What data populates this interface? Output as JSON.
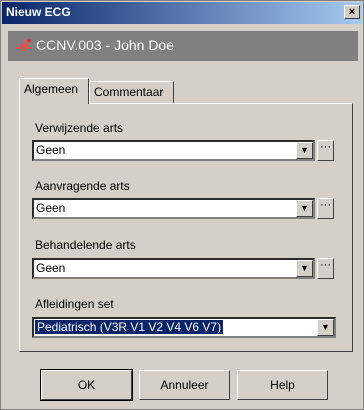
{
  "window": {
    "title": "Nieuw ECG",
    "close_label": "×"
  },
  "header": {
    "icon": "ecg-heart-icon",
    "text": "CCNV.003 - John Doe"
  },
  "tabs": [
    {
      "label": "Algemeen",
      "active": true
    },
    {
      "label": "Commentaar",
      "active": false
    }
  ],
  "fields": {
    "referring": {
      "label": "Verwijzende arts",
      "value": "Geen"
    },
    "requesting": {
      "label": "Aanvragende arts",
      "value": "Geen"
    },
    "treating": {
      "label": "Behandelende arts",
      "value": "Geen"
    },
    "leads": {
      "label": "Afleidingen set",
      "value": "Pediatrisch (V3R V1 V2 V4 V6 V7)"
    }
  },
  "icons": {
    "dropdown": "▼",
    "ellipsis": "···"
  },
  "buttons": {
    "ok": "OK",
    "cancel": "Annuleer",
    "help": "Help"
  },
  "colors": {
    "titlebar_start": "#0a246a",
    "titlebar_end": "#a6caf0",
    "header_bg": "#808080",
    "selection": "#0a246a"
  }
}
